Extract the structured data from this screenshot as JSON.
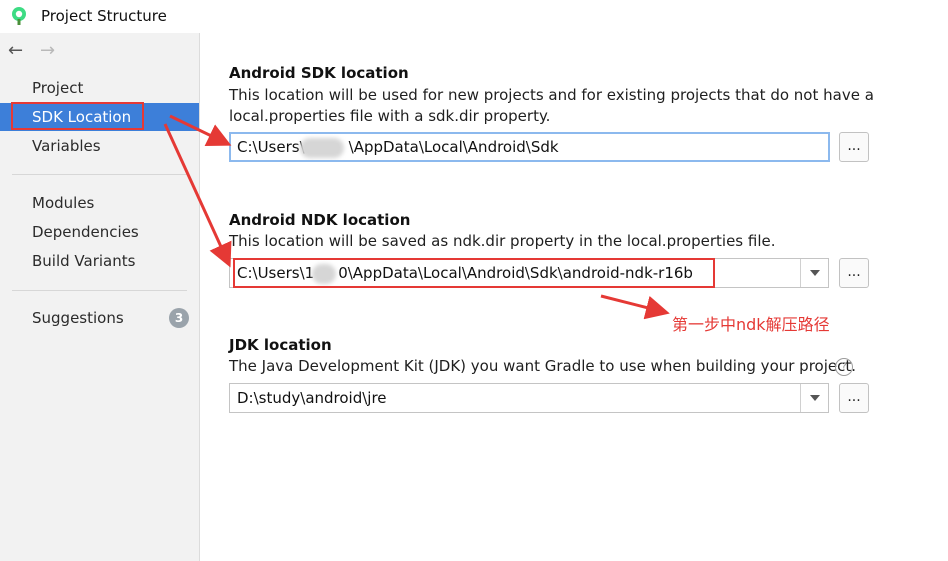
{
  "window": {
    "title": "Project Structure"
  },
  "sidebar": {
    "items": [
      {
        "label": "Project"
      },
      {
        "label": "SDK Location",
        "selected": true
      },
      {
        "label": "Variables"
      },
      {
        "label": "Modules"
      },
      {
        "label": "Dependencies"
      },
      {
        "label": "Build Variants"
      },
      {
        "label": "Suggestions",
        "badge": "3"
      }
    ]
  },
  "sdk": {
    "title": "Android SDK location",
    "desc_line1": "This location will be used for new projects and for existing projects that do not have a",
    "desc_line2": "local.properties file with a sdk.dir property.",
    "value_start": "C:\\Users\\",
    "value_end": "\\AppData\\Local\\Android\\Sdk",
    "browse_label": "..."
  },
  "ndk": {
    "title": "Android NDK location",
    "desc": "This location will be saved as ndk.dir property in the local.properties file.",
    "value_start": "C:\\Users\\1",
    "value_end": "0\\AppData\\Local\\Android\\Sdk\\android-ndk-r16b",
    "browse_label": "..."
  },
  "jdk": {
    "title": "JDK location",
    "desc": "The Java Development Kit (JDK) you want Gradle to use when building your project.",
    "value": "D:\\study\\android\\jre",
    "browse_label": "..."
  },
  "annotation": {
    "text": "第一步中ndk解压路径"
  },
  "colors": {
    "selection": "#3d7fd9",
    "annotation": "#e53935",
    "focus": "#8cb9ee"
  },
  "icons": {
    "app": "android-studio-icon",
    "back": "arrow-left-icon",
    "forward": "arrow-right-icon",
    "help": "question-circle-icon"
  }
}
